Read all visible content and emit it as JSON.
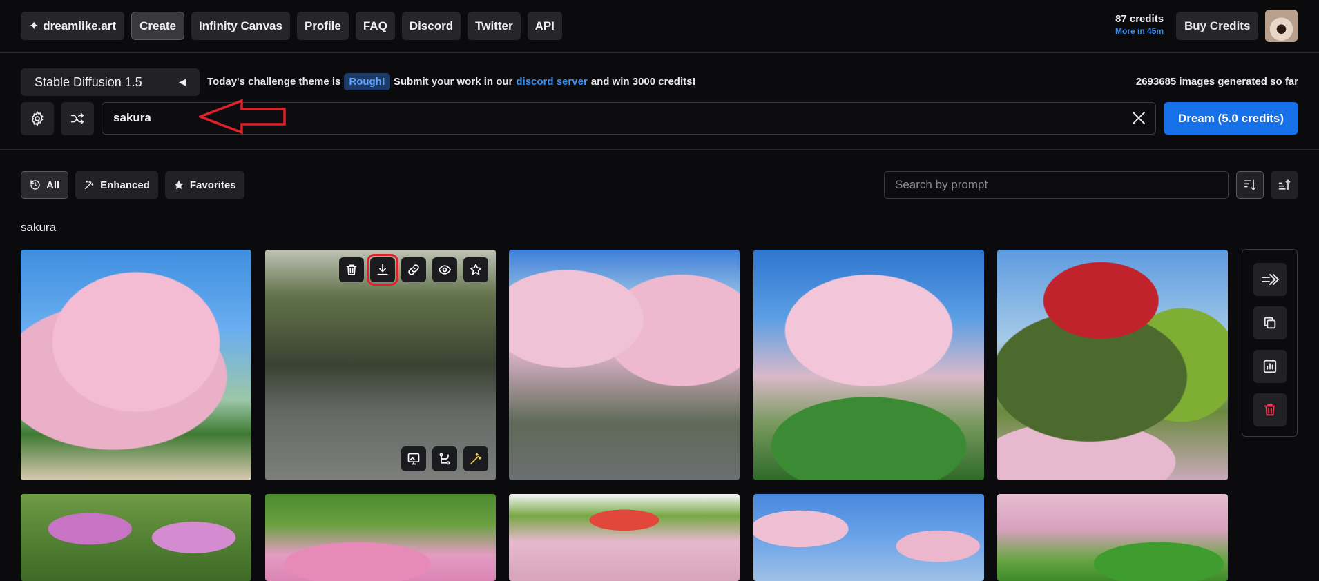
{
  "topbar": {
    "logo": "dreamlike.art",
    "nav": [
      "Create",
      "Infinity Canvas",
      "Profile",
      "FAQ",
      "Discord",
      "Twitter",
      "API"
    ],
    "credits": "87 credits",
    "credits_note": "More in 45m",
    "buy_label": "Buy Credits"
  },
  "generator": {
    "model": "Stable Diffusion 1.5",
    "challenge_prefix": "Today's challenge theme is",
    "challenge_theme": "Rough!",
    "challenge_mid": "Submit your work in our",
    "challenge_link": "discord server",
    "challenge_suffix": "and win 3000 credits!",
    "images_generated": "2693685 images generated so far",
    "prompt_value": "sakura",
    "dream_label": "Dream (5.0 credits)"
  },
  "filters": {
    "all": "All",
    "enhanced": "Enhanced",
    "favorites": "Favorites",
    "search_placeholder": "Search by prompt"
  },
  "gallery": {
    "group_title": "sakura"
  },
  "colors": {
    "accent": "#1670e8",
    "link": "#3b8df0",
    "annotation": "#e0202a",
    "background": "#0b0b0d"
  }
}
